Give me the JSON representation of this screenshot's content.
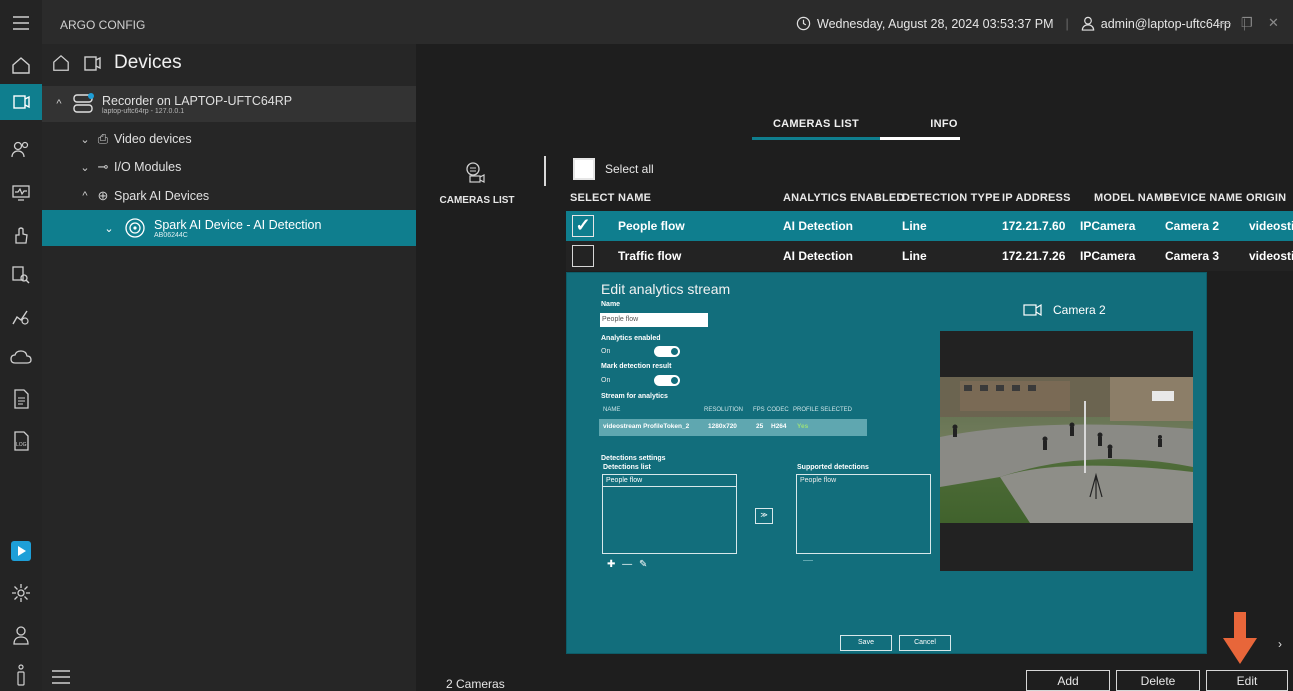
{
  "titlebar": {
    "app_title": "ARGO CONFIG",
    "datetime": "Wednesday, August 28, 2024 03:53:37 PM",
    "user": "admin@laptop-uftc64rp",
    "min": "—",
    "restore": "❐",
    "close": "✕"
  },
  "rail": {
    "icons": [
      "menu-icon",
      "home-icon",
      "devices-icon",
      "users-icon",
      "monitor-icon",
      "hand-icon",
      "search-person-icon",
      "analytics-icon",
      "cloud-icon",
      "report-icon",
      "log-icon",
      "play-logo-icon",
      "settings-icon",
      "user-icon",
      "info-icon"
    ]
  },
  "tree": {
    "header": "Devices",
    "recorder_label": "Recorder on LAPTOP-UFTC64RP",
    "recorder_sub": "laptop-uftc64rp - 127.0.0.1",
    "video_devices": "Video devices",
    "io_modules": "I/O Modules",
    "spark_ai_devices": "Spark AI Devices",
    "ai_device_label": "Spark AI Device - AI Detection",
    "ai_device_sub": "AB06244C"
  },
  "tabs": [
    {
      "label": "CAMERAS LIST",
      "accent": "#0f7e8e"
    },
    {
      "label": "INFO",
      "accent": "#ffffff"
    }
  ],
  "side": {
    "cameras_list": "CAMERAS LIST"
  },
  "select_all": "Select all",
  "table": {
    "headers": [
      "SELECT",
      "NAME",
      "ANALYTICS ENABLED",
      "DETECTION TYPE",
      "IP ADDRESS",
      "MODEL NAME",
      "DEVICE NAME",
      "ORIGIN"
    ],
    "rows": [
      {
        "name": "People flow",
        "analytics": "AI Detection",
        "type": "Line",
        "ip": "172.21.7.60",
        "model": "IPCamera",
        "device": "Camera 2",
        "origin": "videosti",
        "checked": true
      },
      {
        "name": "Traffic flow",
        "analytics": "AI Detection",
        "type": "Line",
        "ip": "172.21.7.26",
        "model": "IPCamera",
        "device": "Camera 3",
        "origin": "videosti",
        "checked": false
      }
    ]
  },
  "dialog": {
    "title": "Edit analytics stream",
    "name_label": "Name",
    "name_value": "People flow",
    "analytics_enabled_label": "Analytics enabled",
    "analytics_enabled_value": "On",
    "mark_detection_label": "Mark detection result",
    "mark_detection_value": "On",
    "stream_label": "Stream for analytics",
    "stream_headers": [
      "NAME",
      "RESOLUTION",
      "FPS",
      "CODEC",
      "PROFILE SELECTED"
    ],
    "stream_row": [
      "videostream ProfileToken_2",
      "1280x720",
      "25",
      "H264",
      "Yes"
    ],
    "detections_settings": "Detections settings",
    "detections_list": "Detections list",
    "detections_item": "People flow",
    "supported_detections": "Supported detections",
    "supported_item": "People flow",
    "move_button": "≫",
    "camera_label": "Camera 2",
    "save": "Save",
    "cancel": "Cancel"
  },
  "footer": {
    "count": "2 Cameras",
    "add": "Add",
    "delete": "Delete",
    "edit": "Edit",
    "next": "›"
  },
  "colors": {
    "accent": "#0f7e8e",
    "dialog_bg": "#126e7c",
    "arrow": "#e8663a"
  }
}
